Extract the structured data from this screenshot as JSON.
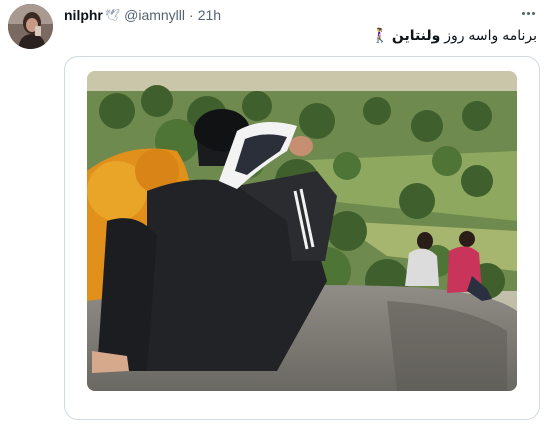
{
  "user": {
    "display_name": "nilphr",
    "name_emoji": "🕊",
    "handle": "@iamnylll",
    "separator": "·",
    "time": "21h"
  },
  "tweet": {
    "text_part1": "برنامه واسه روز",
    "text_part2": "ولنتاین",
    "trailing_emoji": "🚶‍♀️"
  },
  "icons": {
    "more": "more-options-icon"
  },
  "media": {
    "alt": "Man on a rock holding up a shoe toward a couple sitting nearby"
  },
  "colors": {
    "text": "#0f1419",
    "secondary": "#536471",
    "border": "#cfd9de"
  }
}
